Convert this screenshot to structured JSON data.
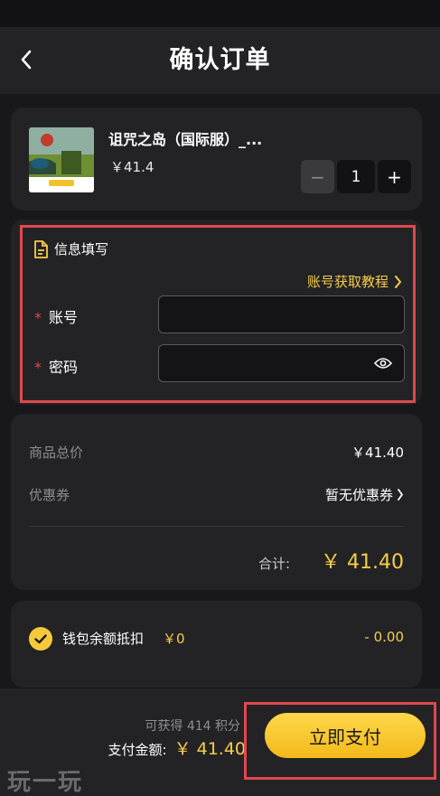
{
  "header": {
    "title": "确认订单",
    "back_icon": "chevron-left-icon"
  },
  "product": {
    "name": "诅咒之岛（国际服）_...",
    "price": "￥41.4",
    "quantity": "1",
    "minus_label": "−",
    "plus_label": "+"
  },
  "info": {
    "title": "信息填写",
    "tutorial_link": "账号获取教程",
    "account_label": "账号",
    "password_label": "密码",
    "required_mark": "*",
    "account_value": "",
    "password_value": ""
  },
  "summary": {
    "goods_total_label": "商品总价",
    "goods_total_value": "￥41.40",
    "coupon_label": "优惠券",
    "coupon_value": "暂无优惠券",
    "total_label": "合计:",
    "total_value": "￥ 41.40"
  },
  "wallet": {
    "label": "钱包余额抵扣",
    "balance": "￥0",
    "deduct": "- 0.00",
    "checked": true
  },
  "bottom": {
    "points": "可获得 414 积分",
    "pay_label": "支付金额:",
    "pay_amount": "￥ 41.40",
    "pay_button": "立即支付"
  },
  "watermark": "玩一玩",
  "colors": {
    "accent": "#f6cd48",
    "highlight": "#e0484f",
    "card": "#232326",
    "background": "#18181a"
  }
}
